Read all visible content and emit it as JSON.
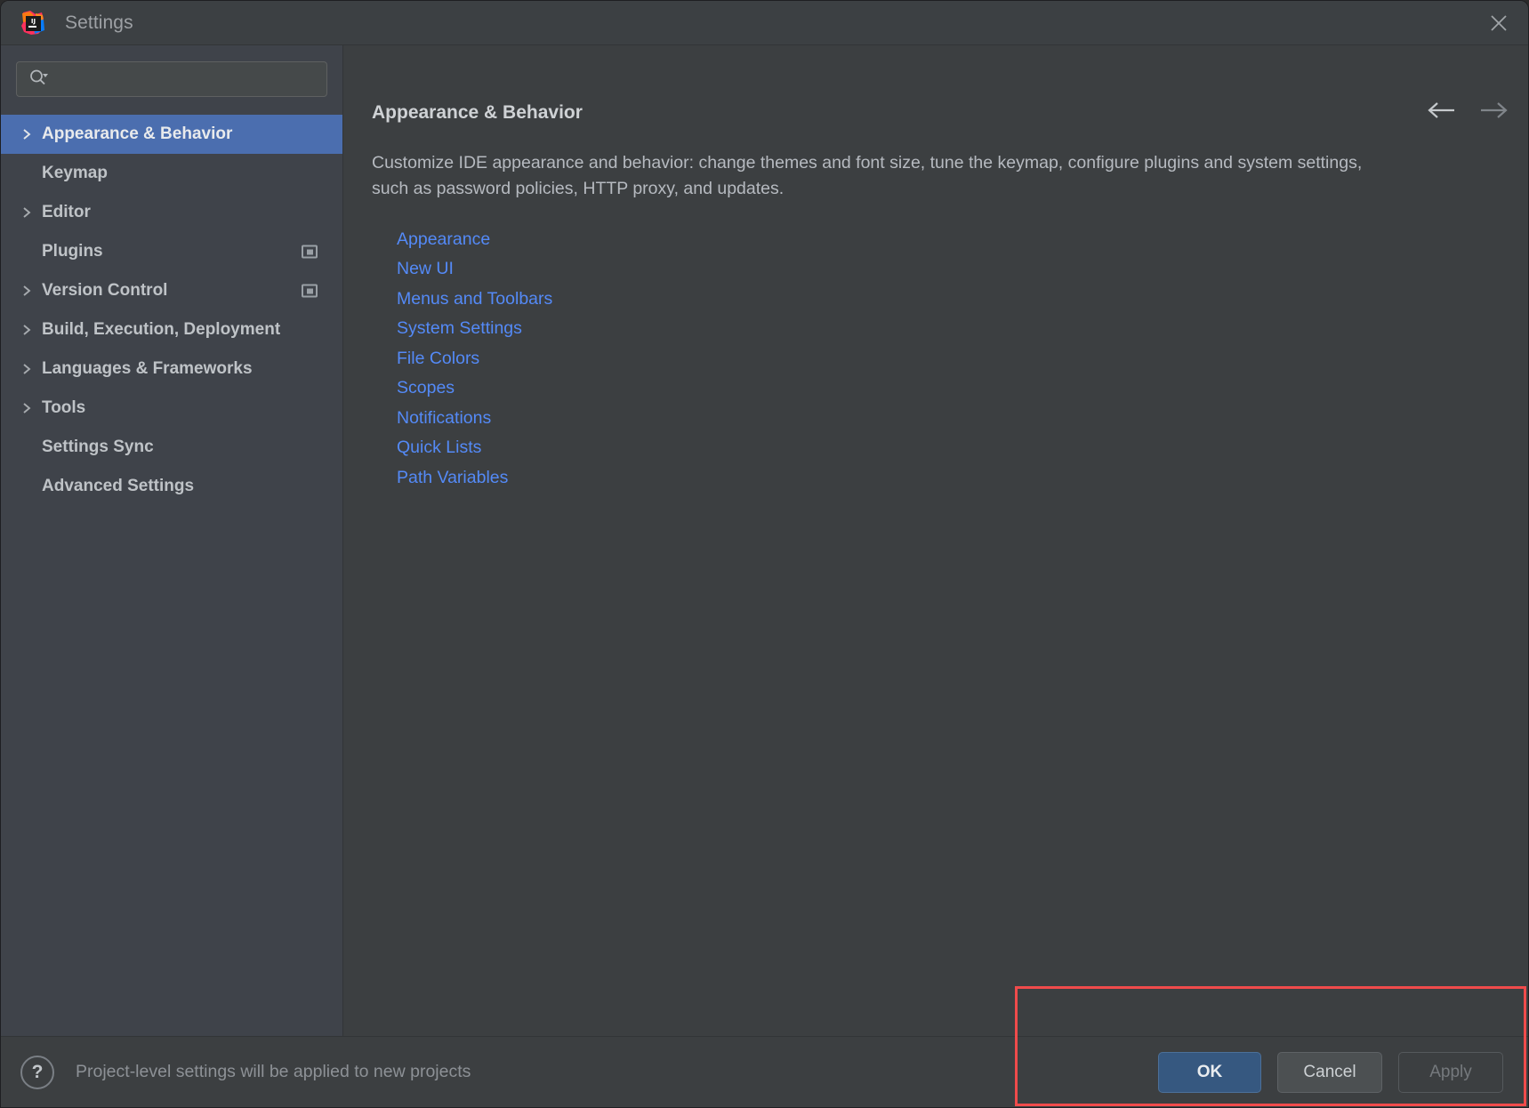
{
  "window": {
    "title": "Settings",
    "app_icon": "intellij-idea-logo",
    "close_icon": "close-icon"
  },
  "sidebar": {
    "search": {
      "placeholder": "",
      "value": "",
      "icon": "search-icon",
      "dropdown_icon": "chevron-down-icon"
    },
    "items": [
      {
        "label": "Appearance & Behavior",
        "expandable": true,
        "selected": true,
        "badge": false
      },
      {
        "label": "Keymap",
        "expandable": false,
        "selected": false,
        "badge": false
      },
      {
        "label": "Editor",
        "expandable": true,
        "selected": false,
        "badge": false
      },
      {
        "label": "Plugins",
        "expandable": false,
        "selected": false,
        "badge": true
      },
      {
        "label": "Version Control",
        "expandable": true,
        "selected": false,
        "badge": true
      },
      {
        "label": "Build, Execution, Deployment",
        "expandable": true,
        "selected": false,
        "badge": false
      },
      {
        "label": "Languages & Frameworks",
        "expandable": true,
        "selected": false,
        "badge": false
      },
      {
        "label": "Tools",
        "expandable": true,
        "selected": false,
        "badge": false
      },
      {
        "label": "Settings Sync",
        "expandable": false,
        "selected": false,
        "badge": false
      },
      {
        "label": "Advanced Settings",
        "expandable": false,
        "selected": false,
        "badge": false
      }
    ]
  },
  "content": {
    "header": "Appearance & Behavior",
    "description": "Customize IDE appearance and behavior: change themes and font size, tune the keymap, configure plugins and system settings, such as password policies, HTTP proxy, and updates.",
    "links": [
      "Appearance",
      "New UI",
      "Menus and Toolbars",
      "System Settings",
      "File Colors",
      "Scopes",
      "Notifications",
      "Quick Lists",
      "Path Variables"
    ],
    "nav": {
      "back_icon": "arrow-left-icon",
      "forward_icon": "arrow-right-icon"
    }
  },
  "footer": {
    "help_icon": "question-mark-icon",
    "note": "Project-level settings will be applied to new projects",
    "buttons": [
      {
        "label": "OK",
        "style": "primary",
        "enabled": true
      },
      {
        "label": "Cancel",
        "style": "default",
        "enabled": true
      },
      {
        "label": "Apply",
        "style": "disabled",
        "enabled": false
      }
    ]
  },
  "colors": {
    "selection_blue": "#4b6eaf",
    "link_blue": "#548af7",
    "primary_button": "#365880",
    "annotation_red": "#f04b4b",
    "sidebar_bg": "#3f434a",
    "content_bg": "#3c3f41"
  }
}
